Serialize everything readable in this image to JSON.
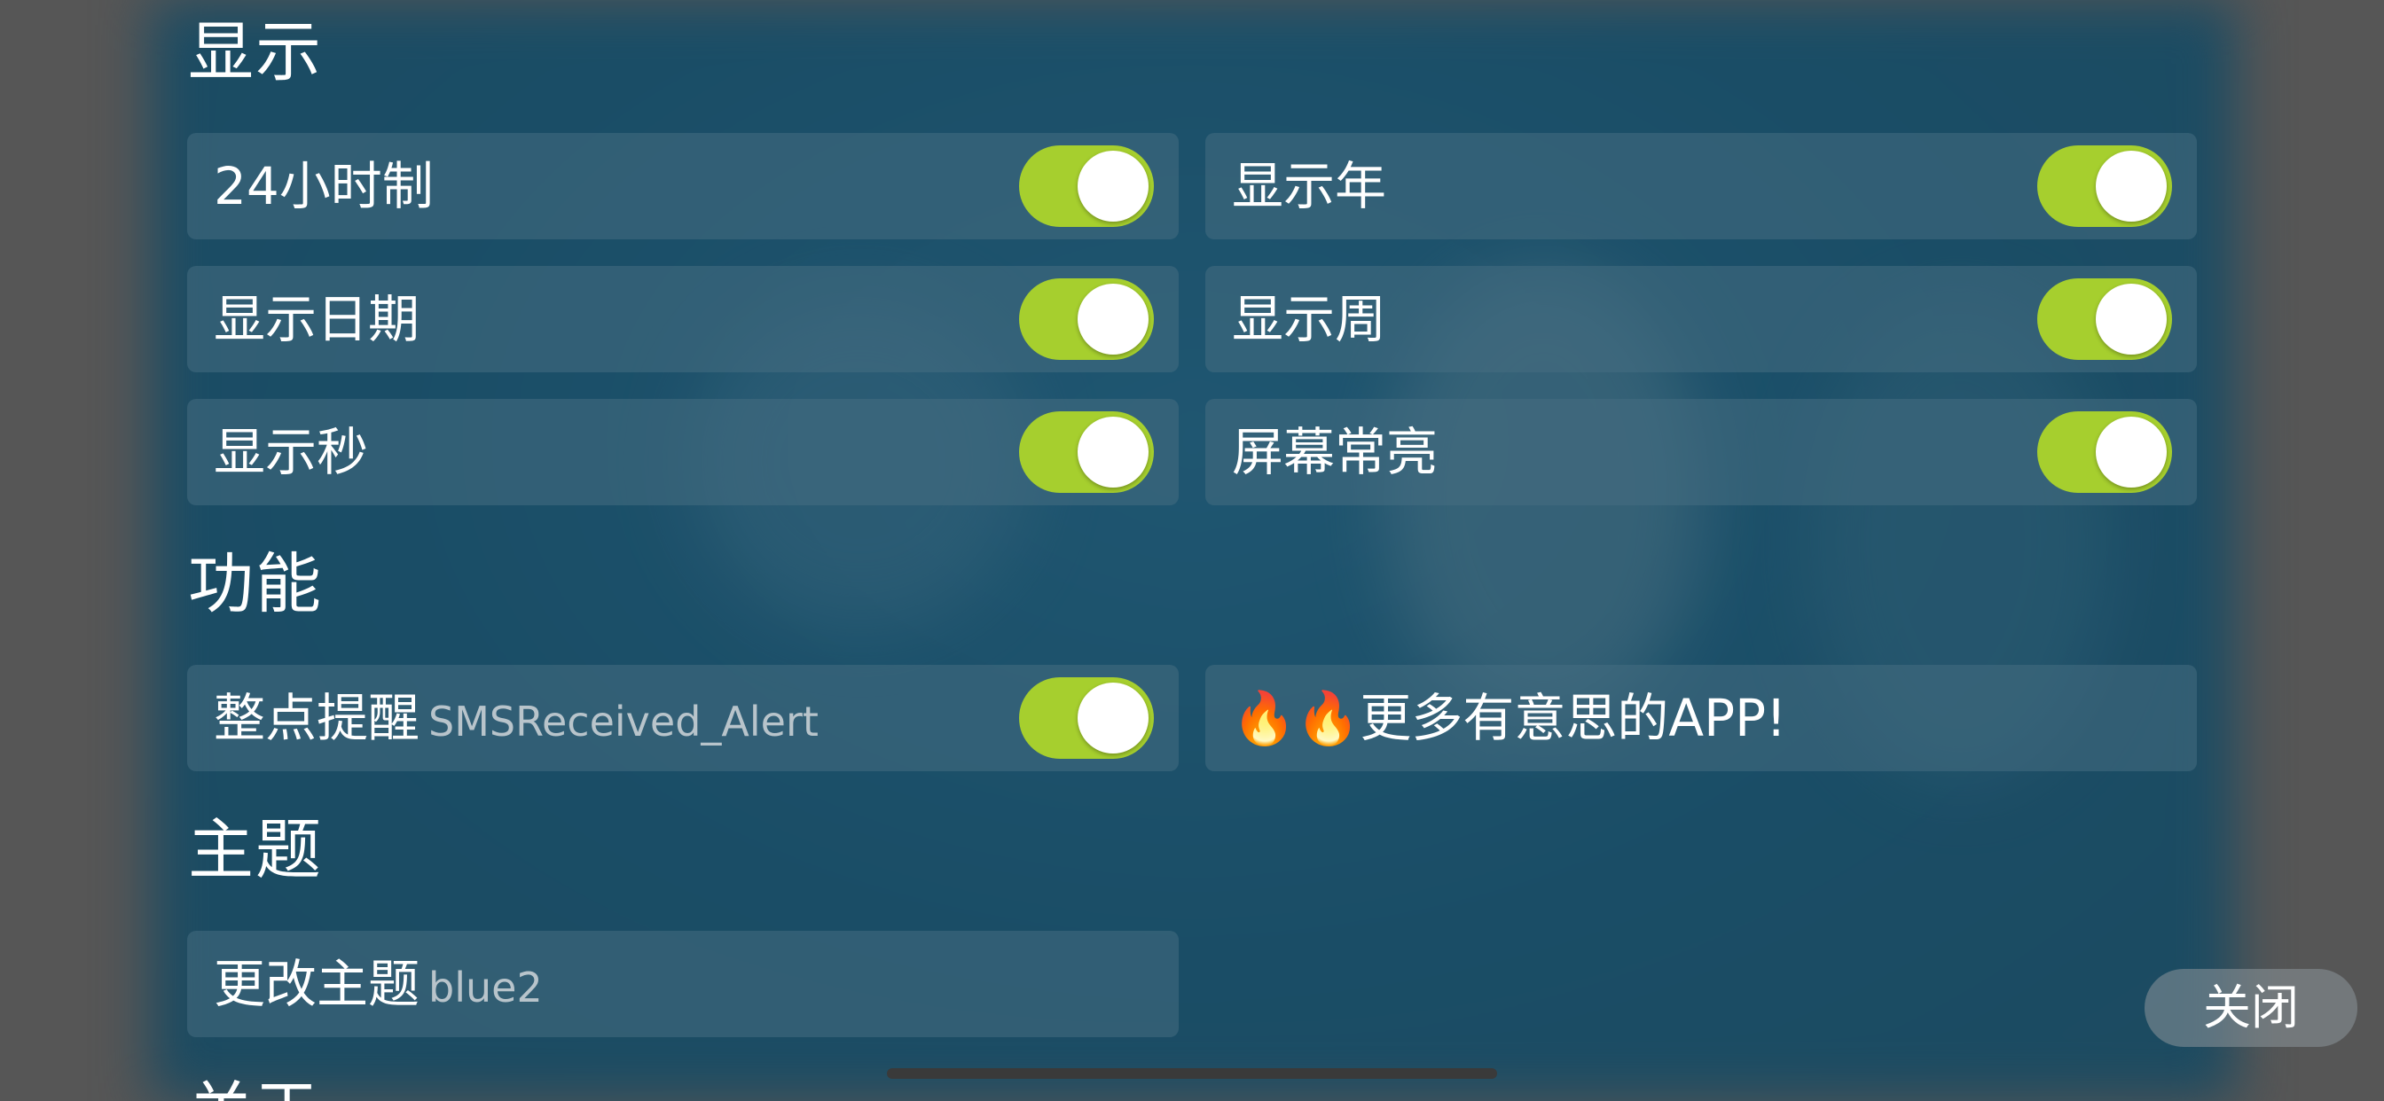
{
  "sections": {
    "display": {
      "title": "显示",
      "items": [
        {
          "label": "24小时制",
          "on": true
        },
        {
          "label": "显示年",
          "on": true
        },
        {
          "label": "显示日期",
          "on": true
        },
        {
          "label": "显示周",
          "on": true
        },
        {
          "label": "显示秒",
          "on": true
        },
        {
          "label": "屏幕常亮",
          "on": true
        }
      ]
    },
    "features": {
      "title": "功能",
      "hourly_alert": {
        "label": "整点提醒",
        "value": "SMSReceived_Alert",
        "on": true
      },
      "more_apps": {
        "label": "🔥🔥更多有意思的APP!"
      }
    },
    "theme": {
      "title": "主题",
      "change_theme": {
        "label": "更改主题",
        "value": "blue2"
      }
    },
    "about": {
      "title": "关于"
    }
  },
  "close_button": "关闭",
  "colors": {
    "toggle_on": "#a6cf2e",
    "card_bg": "#466e82",
    "background": "#1a4d66",
    "outer": "#565656"
  }
}
